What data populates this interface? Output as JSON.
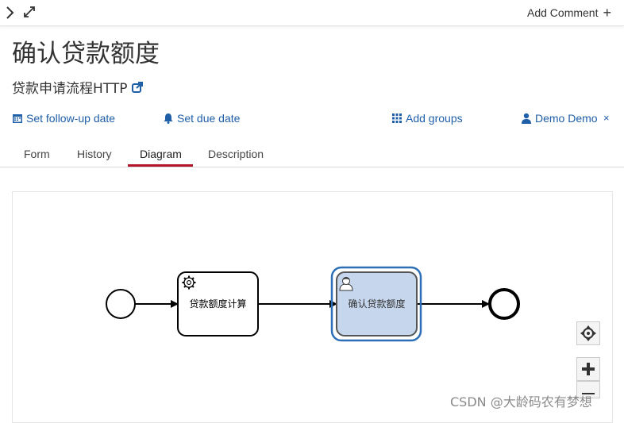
{
  "header": {
    "add_comment_label": "Add Comment",
    "add_comment_icon": "plus-icon"
  },
  "task": {
    "title": "确认贷款额度",
    "process_name": "贷款申请流程HTTP"
  },
  "actions": {
    "follow_up_label": "Set follow-up date",
    "due_date_label": "Set due date",
    "groups_label": "Add groups",
    "assignee_label": "Demo Demo",
    "remove_label": "×"
  },
  "tabs": [
    {
      "label": "Form",
      "active": false
    },
    {
      "label": "History",
      "active": false
    },
    {
      "label": "Diagram",
      "active": true
    },
    {
      "label": "Description",
      "active": false
    }
  ],
  "diagram": {
    "service_task_label": "贷款额度计算",
    "user_task_label": "确认贷款额度",
    "highlight_color": "#c5d6ed",
    "highlight_border": "#2c6fb6"
  },
  "watermark": "CSDN @大龄码农有梦想",
  "colors": {
    "link": "#1f5fa8",
    "active_tab": "#b5152b"
  }
}
